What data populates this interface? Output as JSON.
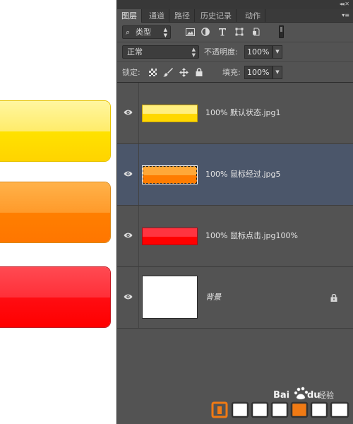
{
  "panel": {
    "tabs": [
      "图层",
      "通道",
      "路径",
      "历史记录",
      "动作"
    ],
    "active_tab": 0,
    "filter_kind": "类型",
    "blend_mode": "正常",
    "opacity_label": "不透明度:",
    "opacity_value": "100%",
    "lock_label": "锁定:",
    "fill_label": "填充:",
    "fill_value": "100%"
  },
  "layers": [
    {
      "opacity_text": "100%",
      "name": "默认状态.jpg1",
      "style": "yellow",
      "selected": false
    },
    {
      "opacity_text": "100%",
      "name": "鼠标经过.jpg5",
      "style": "orange",
      "selected": true
    },
    {
      "opacity_text": "100%",
      "name": "鼠标点击.jpg100%",
      "style": "red",
      "selected": false
    },
    {
      "opacity_text": "",
      "name": "背景",
      "style": "white",
      "selected": false,
      "locked": true
    }
  ],
  "canvas": {
    "buttons": [
      {
        "style": "yellow",
        "top_color": "#fff29a",
        "bottom_color": "#ffe000"
      },
      {
        "style": "orange",
        "top_color": "#ffa83c",
        "bottom_color": "#ff7a00"
      },
      {
        "style": "red",
        "top_color": "#ff3a44",
        "bottom_color": "#ff0000"
      }
    ]
  },
  "colors": {
    "panel_bg": "#535353",
    "selected_row": "#4b566a",
    "tab_bar": "#3a3a3a"
  },
  "watermark": {
    "brand": "Bai",
    "paw": "du",
    "suffix": "经验"
  }
}
